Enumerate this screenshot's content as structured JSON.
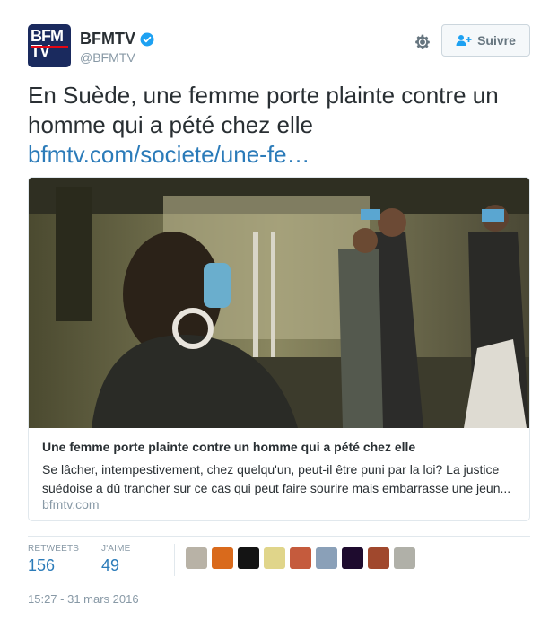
{
  "account": {
    "name": "BFMTV",
    "handle": "@BFMTV",
    "avatar_text": "BFM TV",
    "follow_label": "Suivre"
  },
  "tweet": {
    "text": "En Suède, une femme porte plainte contre un homme qui a pété chez elle",
    "link": "bfmtv.com/societe/une-fe…"
  },
  "card": {
    "title": "Une femme porte plainte contre un homme qui a pété chez elle",
    "description": "Se lâcher, intempestivement, chez quelqu'un, peut-il être puni par la loi? La justice suédoise a dû trancher sur ce cas qui peut faire sourire mais embarrasse une jeun...",
    "domain": "bfmtv.com"
  },
  "stats": {
    "retweets_label": "RETWEETS",
    "retweets_value": "156",
    "likes_label": "J'AIME",
    "likes_value": "49"
  },
  "timestamp": "15:27 - 31 mars 2016",
  "icons": {
    "verified": "verified-badge-icon",
    "settings": "gear-icon",
    "follow": "add-user-icon"
  },
  "colors": {
    "link": "#2b7bb9",
    "verified": "#1da1f2",
    "avatar_bg": "#1a2a5e",
    "muted": "#8899a6"
  },
  "liker_avatars": [
    {
      "color": "#b8b2a6"
    },
    {
      "color": "#d96a1c"
    },
    {
      "color": "#141414"
    },
    {
      "color": "#e0d58a"
    },
    {
      "color": "#c55b3d"
    },
    {
      "color": "#8aa0b8"
    },
    {
      "color": "#1e0b2e"
    },
    {
      "color": "#a0482d"
    },
    {
      "color": "#b0b0a8"
    }
  ]
}
